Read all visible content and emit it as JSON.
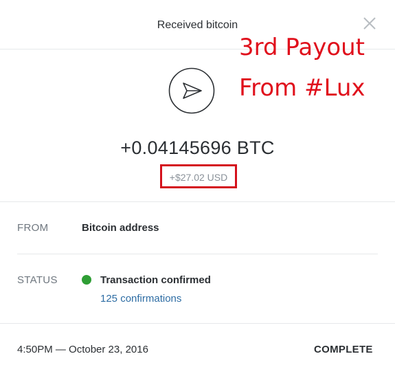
{
  "header": {
    "title": "Received bitcoin",
    "close_icon": "close-icon"
  },
  "annotation": {
    "line1": "3rd Payout",
    "line2": "From #Lux",
    "color": "#e0101c"
  },
  "transaction": {
    "icon": "send-arrow-icon",
    "amount_btc": "+0.04145696 BTC",
    "amount_usd": "+$27.02 USD",
    "highlight_color": "#d4111c"
  },
  "details": {
    "from_label": "FROM",
    "from_value": "Bitcoin address",
    "status_label": "STATUS",
    "status_value": "Transaction confirmed",
    "status_color": "#2f9e35",
    "confirmations": "125 confirmations"
  },
  "footer": {
    "timestamp": "4:50PM — October 23, 2016",
    "state": "COMPLETE"
  }
}
